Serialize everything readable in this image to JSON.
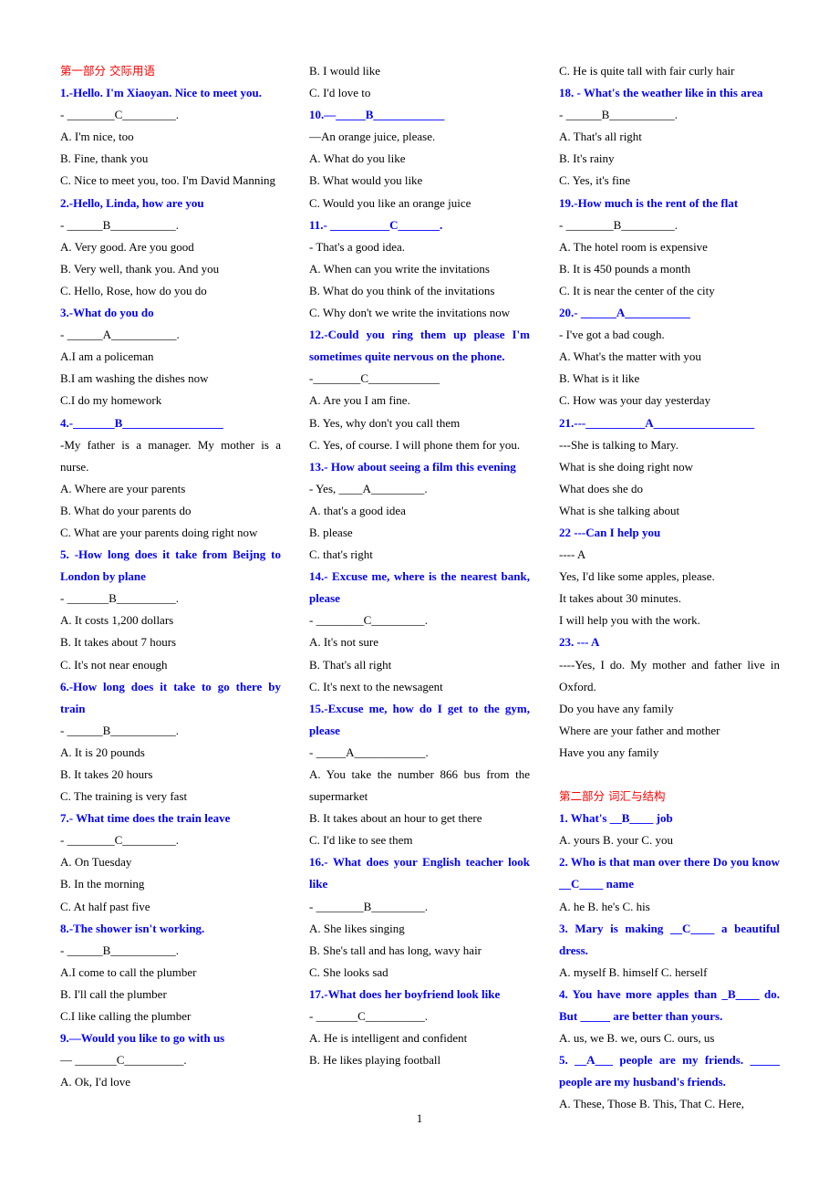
{
  "page_number": "1",
  "colors": {
    "section_title": "#ff0000",
    "question": "#0000ff",
    "body_text": "#000000"
  },
  "columns": [
    {
      "lines": [
        {
          "type": "section-title",
          "text": "第一部分  交际用语"
        },
        {
          "type": "q",
          "text": "1.-Hello. I'm Xiaoyan. Nice to meet you."
        },
        {
          "type": "t",
          "text": "- ________C_________."
        },
        {
          "type": "t",
          "text": "A. I'm nice, too"
        },
        {
          "type": "t",
          "text": "B. Fine, thank you"
        },
        {
          "type": "t",
          "text": "C. Nice to meet you, too. I'm David Manning"
        },
        {
          "type": "q",
          "text": "2.-Hello, Linda, how are you"
        },
        {
          "type": "t",
          "text": "- ______B___________."
        },
        {
          "type": "t",
          "text": "A. Very good. Are you good"
        },
        {
          "type": "t",
          "text": "B. Very well, thank you. And you"
        },
        {
          "type": "t",
          "text": "C. Hello, Rose, how do you do"
        },
        {
          "type": "q",
          "text": "3.-What do you do"
        },
        {
          "type": "t",
          "text": "- ______A___________."
        },
        {
          "type": "t",
          "text": "A.I am a policeman"
        },
        {
          "type": "t",
          "text": "B.I am washing the dishes now"
        },
        {
          "type": "t",
          "text": "C.I do my homework"
        },
        {
          "type": "q",
          "text": "4.-_______B_________________"
        },
        {
          "type": "t",
          "text": "-My father is a manager. My mother is a nurse."
        },
        {
          "type": "t",
          "text": "A. Where are your parents"
        },
        {
          "type": "t",
          "text": "B. What do your parents do"
        },
        {
          "type": "t",
          "text": "C. What are your parents doing right now"
        },
        {
          "type": "q",
          "text": "5. -How long does it take from Beijng to London by plane"
        },
        {
          "type": "t",
          "text": "- _______B__________."
        },
        {
          "type": "t",
          "text": "A. It costs 1,200 dollars"
        },
        {
          "type": "t",
          "text": "B. It takes about 7 hours"
        },
        {
          "type": "t",
          "text": "C. It's not near enough"
        },
        {
          "type": "q",
          "text": "6.-How long does it take to go there by train"
        },
        {
          "type": "t",
          "text": "- ______B___________."
        },
        {
          "type": "t",
          "text": "A. It is 20 pounds"
        },
        {
          "type": "t",
          "text": "B. It takes 20 hours"
        },
        {
          "type": "t",
          "text": "C. The training is very fast"
        },
        {
          "type": "q",
          "text": "7.- What time does the train leave"
        },
        {
          "type": "t",
          "text": "- ________C_________."
        },
        {
          "type": "t",
          "text": "A. On Tuesday"
        },
        {
          "type": "t",
          "text": "B. In the morning"
        },
        {
          "type": "t",
          "text": "C. At half past five"
        },
        {
          "type": "q",
          "text": "8.-The shower isn't working."
        },
        {
          "type": "t",
          "text": "- ______B___________."
        },
        {
          "type": "t",
          "text": "A.I come to call the plumber"
        },
        {
          "type": "t",
          "text": "B. I'll call the plumber"
        },
        {
          "type": "t",
          "text": "C.I like calling the plumber"
        },
        {
          "type": "q",
          "text": "9.—Would you like to go with us"
        },
        {
          "type": "t",
          "text": "— _______C__________."
        },
        {
          "type": "t",
          "text": "A. Ok, I'd love"
        }
      ]
    },
    {
      "lines": [
        {
          "type": "t",
          "text": "B. I would like"
        },
        {
          "type": "t",
          "text": "C. I'd love to"
        },
        {
          "type": "q",
          "text": "10.—_____B____________"
        },
        {
          "type": "t",
          "text": "—An orange juice, please."
        },
        {
          "type": "t",
          "text": "A. What do you like"
        },
        {
          "type": "t",
          "text": "B. What would you like"
        },
        {
          "type": "t",
          "text": "C. Would you like an orange juice"
        },
        {
          "type": "q",
          "text": "11.- __________C_______."
        },
        {
          "type": "t",
          "text": "- That's a good idea."
        },
        {
          "type": "t",
          "text": "A. When can you write the invitations"
        },
        {
          "type": "t",
          "text": "B. What do you think of the invitations"
        },
        {
          "type": "t",
          "text": "C. Why don't we write the invitations now"
        },
        {
          "type": "q",
          "text": "12.-Could you ring them up please I'm sometimes quite nervous on the phone."
        },
        {
          "type": "t",
          "text": "-________C____________"
        },
        {
          "type": "t",
          "text": "A. Are you I am fine."
        },
        {
          "type": "t",
          "text": "B. Yes, why don't you call them"
        },
        {
          "type": "t",
          "text": "C. Yes, of course. I will phone them for you."
        },
        {
          "type": "q",
          "text": "13.- How about seeing a film this evening"
        },
        {
          "type": "t",
          "text": "- Yes, ____A_________."
        },
        {
          "type": "t",
          "text": "A. that's a good idea"
        },
        {
          "type": "t",
          "text": "B. please"
        },
        {
          "type": "t",
          "text": "C. that's right"
        },
        {
          "type": "q",
          "text": "14.- Excuse me, where is the nearest bank, please"
        },
        {
          "type": "t",
          "text": "- ________C_________."
        },
        {
          "type": "t",
          "text": "A. It's not sure"
        },
        {
          "type": "t",
          "text": "B. That's all right"
        },
        {
          "type": "t",
          "text": "C. It's next to the newsagent"
        },
        {
          "type": "q",
          "text": "15.-Excuse me, how do I get to the gym, please"
        },
        {
          "type": "t",
          "text": "- _____A____________."
        },
        {
          "type": "t",
          "text": "A. You take the number 866 bus from the supermarket"
        },
        {
          "type": "t",
          "text": "B. It takes about an hour to get there"
        },
        {
          "type": "t",
          "text": "C. I'd like to see them"
        },
        {
          "type": "q",
          "text": "16.- What does your English teacher look like"
        },
        {
          "type": "t",
          "text": "- ________B_________."
        },
        {
          "type": "t",
          "text": "A. She likes singing"
        },
        {
          "type": "t",
          "text": "B. She's tall and has long, wavy hair"
        },
        {
          "type": "t",
          "text": "C. She looks sad"
        },
        {
          "type": "q",
          "text": "17.-What does her boyfriend look like"
        },
        {
          "type": "t",
          "text": "- _______C__________."
        },
        {
          "type": "t",
          "text": "A. He is intelligent and confident"
        },
        {
          "type": "t",
          "text": "B. He likes playing football"
        }
      ]
    },
    {
      "lines": [
        {
          "type": "t",
          "text": "C. He is quite tall with fair curly hair"
        },
        {
          "type": "q",
          "text": "18. - What's the weather like in this area"
        },
        {
          "type": "t",
          "text": "- ______B___________."
        },
        {
          "type": "t",
          "text": "A. That's all right"
        },
        {
          "type": "t",
          "text": "B. It's rainy"
        },
        {
          "type": "t",
          "text": "C. Yes, it's fine"
        },
        {
          "type": "q",
          "text": "19.-How much is the rent of the flat"
        },
        {
          "type": "t",
          "text": "- ________B_________."
        },
        {
          "type": "t",
          "text": "A. The hotel room is expensive"
        },
        {
          "type": "t",
          "text": "B. It is 450 pounds a month"
        },
        {
          "type": "t",
          "text": "C. It is near the center of the city"
        },
        {
          "type": "q",
          "text": "20.- ______A___________"
        },
        {
          "type": "t",
          "text": "- I've got a bad cough."
        },
        {
          "type": "t",
          "text": "A. What's the matter with you"
        },
        {
          "type": "t",
          "text": "B. What is it like"
        },
        {
          "type": "t",
          "text": "C. How was your day yesterday"
        },
        {
          "type": "q",
          "text": "21.---__________A_________________"
        },
        {
          "type": "t",
          "text": "---She is talking to Mary."
        },
        {
          "type": "t",
          "text": "What is she doing right now"
        },
        {
          "type": "t",
          "text": "What does she do"
        },
        {
          "type": "t",
          "text": "What is she talking about"
        },
        {
          "type": "q",
          "text": "22 ---Can I help you"
        },
        {
          "type": "t",
          "text": "---- A"
        },
        {
          "type": "t",
          "text": "Yes, I'd like some apples, please."
        },
        {
          "type": "t",
          "text": "It takes about 30 minutes."
        },
        {
          "type": "t",
          "text": "I will help you with the work."
        },
        {
          "type": "q",
          "text": "23. --- A"
        },
        {
          "type": "t",
          "text": "----Yes, I do. My mother and father live in Oxford."
        },
        {
          "type": "t",
          "text": "Do you have any family"
        },
        {
          "type": "t",
          "text": "Where are your father and mother"
        },
        {
          "type": "t",
          "text": "Have you any family"
        },
        {
          "type": "gap",
          "text": ""
        },
        {
          "type": "section-title",
          "text": "第二部分  词汇与结构"
        },
        {
          "type": "q",
          "text": "1. What's __B____ job"
        },
        {
          "type": "t",
          "text": "A. yours B. your C. you"
        },
        {
          "type": "q",
          "text": "2. Who is that man over there Do you know __C____ name"
        },
        {
          "type": "t",
          "text": "A. he B. he's C. his"
        },
        {
          "type": "q",
          "text": "3. Mary is making __C____ a beautiful dress."
        },
        {
          "type": "t",
          "text": "A. myself B. himself C. herself"
        },
        {
          "type": "q",
          "text": "4. You have more apples than _B____ do. But _____ are better than yours."
        },
        {
          "type": "t",
          "text": "A. us, we B. we, ours C. ours, us"
        },
        {
          "type": "q",
          "text": "5. __A___ people are my friends. _____ people are my husband's friends."
        },
        {
          "type": "t",
          "text": "A. These, Those B. This, That C. Here,"
        }
      ]
    }
  ]
}
